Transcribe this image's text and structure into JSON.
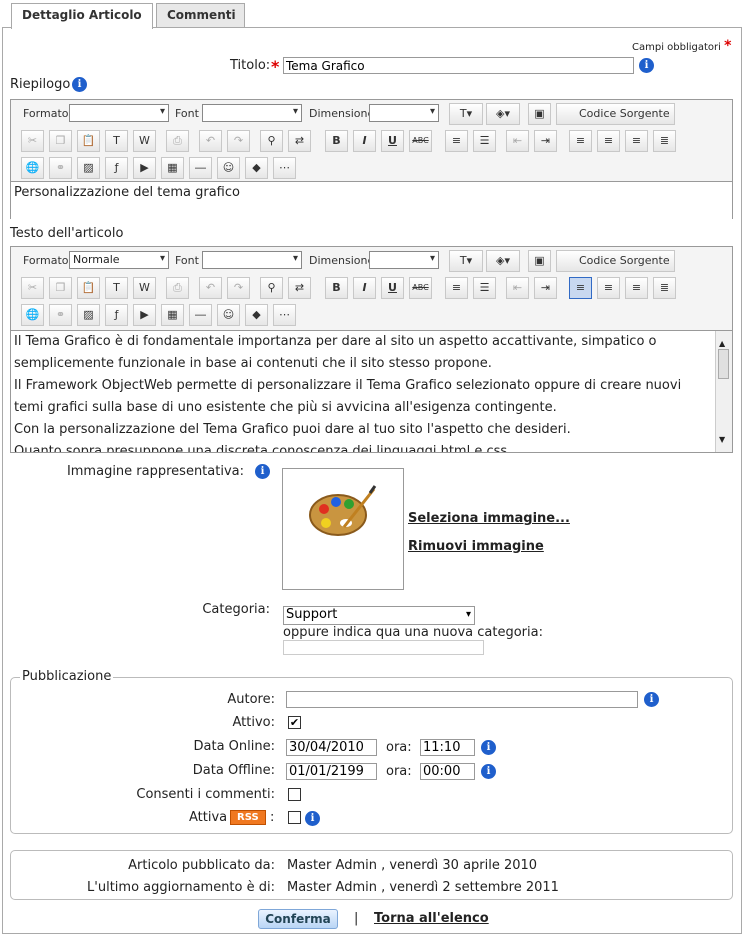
{
  "tabs": [
    "Dettaglio Articolo",
    "Commenti"
  ],
  "required_note": "Campi obbligatori",
  "titolo": {
    "label": "Titolo:",
    "value": "Tema Grafico"
  },
  "riepilogo": {
    "label": "Riepilogo",
    "content": "Personalizzazione del tema grafico",
    "formato": ""
  },
  "testo": {
    "label": "Testo dell'articolo",
    "formato": "Normale",
    "paragraphs": [
      "Il Tema Grafico è di fondamentale importanza per dare al sito un aspetto accattivante, simpatico o semplicemente funzionale in base ai contenuti che il sito stesso propone.",
      "Il Framework ObjectWeb permette di personalizzare il Tema Grafico selezionato oppure di creare nuovi temi grafici sulla base di uno esistente che più si avvicina all'esigenza contingente.",
      "Con la personalizzazione del Tema Grafico puoi dare al tuo sito l'aspetto che desideri.",
      "Quanto sopra presuppone una discreta conoscenza dei linguaggi html e css."
    ]
  },
  "toolbar": {
    "formato": "Formato",
    "font": "Font",
    "dimensione": "Dimensione",
    "codice": "Codice Sorgente",
    "b": "B",
    "i": "I",
    "u": "U",
    "abc": "ABC"
  },
  "immagine": {
    "label": "Immagine rappresentativa:",
    "select": "Seleziona immagine...",
    "remove": "Rimuovi immagine"
  },
  "categoria": {
    "label": "Categoria:",
    "value": "Support",
    "hint": "oppure indica qua una nuova categoria:"
  },
  "pubblicazione": {
    "legend": "Pubblicazione",
    "autore": "Autore:",
    "attivo": "Attivo:",
    "data_online": "Data Online:",
    "online_date": "30/04/2010",
    "online_time": "11:10",
    "data_offline": "Data Offline:",
    "offline_date": "01/01/2199",
    "offline_time": "00:00",
    "ora": "ora:",
    "commenti": "Consenti i commenti:",
    "attiva": "Attiva",
    "rss": "RSS",
    "colon": ":"
  },
  "info_box": {
    "pub_label": "Articolo pubblicato da:",
    "pub_value": "Master Admin ,  venerdì 30 aprile 2010",
    "upd_label": "L'ultimo aggiornamento è di:",
    "upd_value": "Master Admin ,  venerdì 2 settembre 2011"
  },
  "actions": {
    "confirm": "Conferma",
    "sep": "|",
    "back": "Torna all'elenco"
  }
}
